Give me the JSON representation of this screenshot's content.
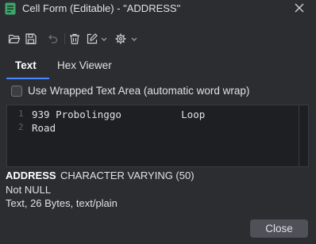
{
  "window": {
    "title": "Cell Form (Editable) - \"ADDRESS\""
  },
  "toolbar": {
    "icons": [
      "open-folder-icon",
      "save-icon",
      "undo-icon",
      "delete-icon",
      "edit-icon",
      "chevron-down-icon",
      "settings-icon",
      "chevron-down-icon"
    ]
  },
  "tabs": [
    {
      "label": "Text",
      "active": true
    },
    {
      "label": "Hex Viewer",
      "active": false
    }
  ],
  "wrap": {
    "label": "Use Wrapped Text Area (automatic word wrap)",
    "checked": false
  },
  "editor": {
    "line_numbers": [
      "1",
      "2"
    ],
    "content": "939 Probolinggo          Loop\nRoad"
  },
  "column_info": {
    "name": "ADDRESS",
    "type": "CHARACTER VARYING (50)",
    "nullability": "Not NULL",
    "summary": "Text, 26 Bytes, text/plain"
  },
  "buttons": {
    "close_label": "Close"
  },
  "colors": {
    "background": "#2b2d30",
    "editor_bg": "#1e1f22",
    "accent": "#4a88ff",
    "button_bg": "#4e5157"
  }
}
